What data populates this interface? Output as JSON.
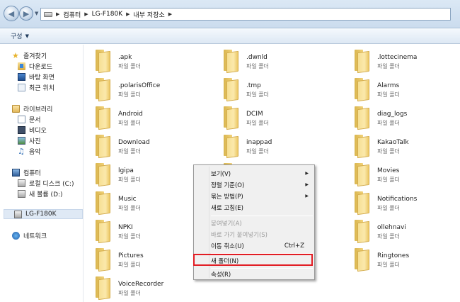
{
  "address": {
    "crumbs": [
      "컴퓨터",
      "LG-F180K",
      "내부 저장소"
    ]
  },
  "toolbar": {
    "organize_label": "구성"
  },
  "sidebar": {
    "favorites": "즐겨찾기",
    "downloads": "다운로드",
    "desktop": "바탕 화면",
    "recent": "최근 위치",
    "libraries": "라이브러리",
    "documents": "문서",
    "videos": "비디오",
    "pictures": "사진",
    "music": "음악",
    "computer": "컴퓨터",
    "local_disk": "로컬 디스크 (C:)",
    "new_volume": "새 볼륨 (D:)",
    "device": "LG-F180K",
    "network": "네트워크"
  },
  "folder_type": "파일 폴더",
  "folders": [
    ".apk",
    ".dwnld",
    ".lottecinema",
    ".polarisOffice",
    ".tmp",
    "Alarms",
    "Android",
    "DCIM",
    "diag_logs",
    "Download",
    "inappad",
    "KakaoTalk",
    "lgipa",
    "",
    "Movies",
    "Music",
    "",
    "Notifications",
    "NPKI",
    "",
    "ollehnavi",
    "Pictures",
    "",
    "Ringtones",
    "VoiceRecorder"
  ],
  "context_menu": {
    "view": "보기(V)",
    "sort_by": "정렬 기준(O)",
    "group_by": "묶는 방법(P)",
    "refresh": "새로 고침(E)",
    "paste": "붙여넣기(A)",
    "paste_shortcut": "바로 가기 붙여넣기(S)",
    "undo_move": "이동 취소(U)",
    "undo_shortcut": "Ctrl+Z",
    "new_folder": "새 폴더(N)",
    "properties": "속성(R)"
  },
  "colors": {
    "highlight_border": "#e21d24",
    "selected_nav": "#dfe9f5"
  }
}
